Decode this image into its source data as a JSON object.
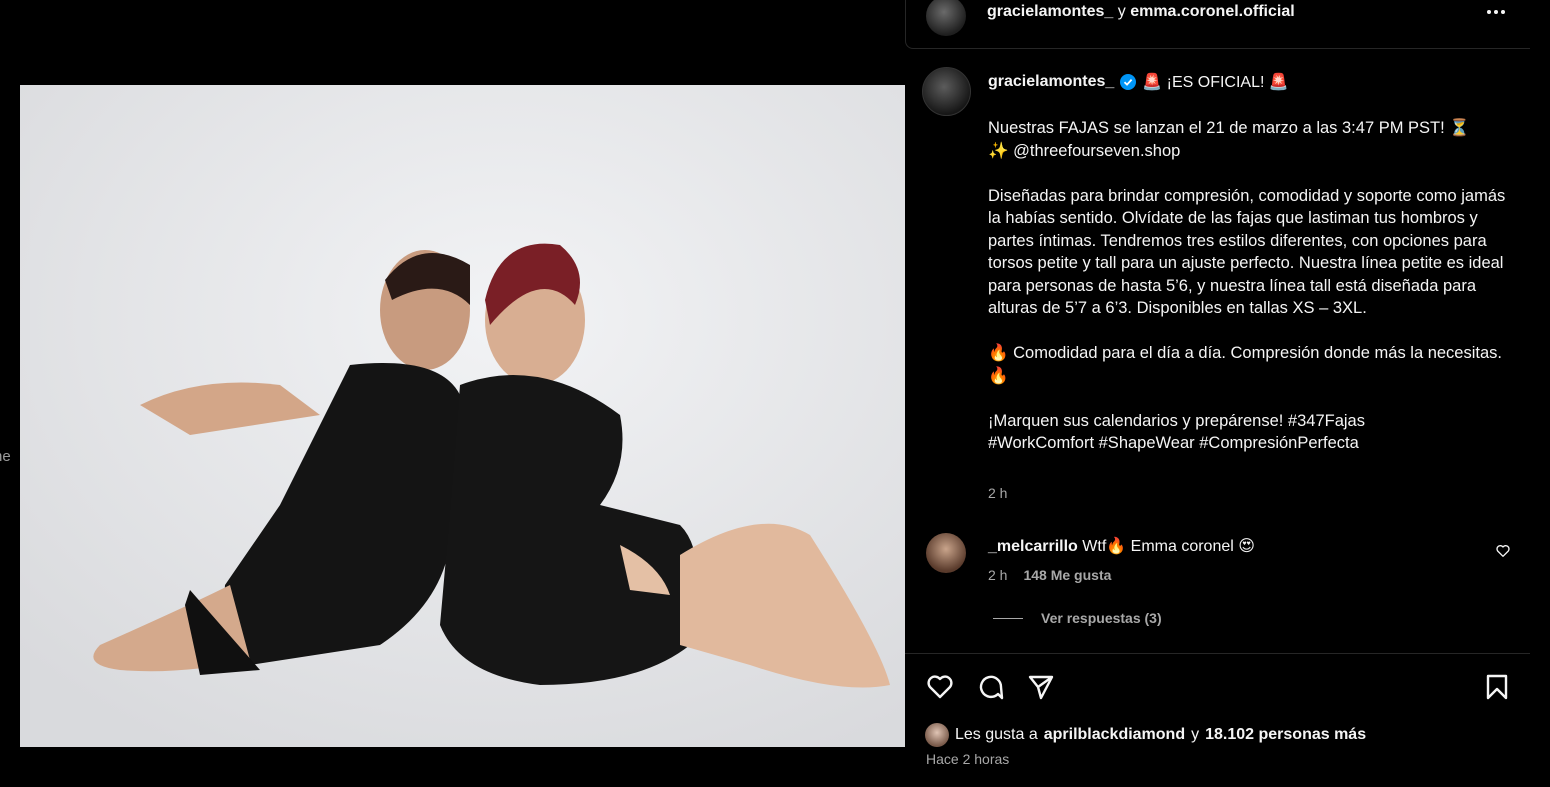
{
  "side_peek_text": "ne",
  "header": {
    "user1": "gracielamontes_",
    "separator": "y",
    "user2": "emma.coronel.official"
  },
  "post": {
    "author": "gracielamontes_",
    "title_line": "🚨 ¡ES OFICIAL! 🚨",
    "caption": "Nuestras FAJAS se lanzan el 21 de marzo a las 3:47 PM PST! ⏳\n✨ @threefourseven.shop\n\nDiseñadas para brindar compresión, comodidad y soporte como jamás la habías sentido. Olvídate de las fajas que lastiman tus hombros y partes íntimas. Tendremos tres estilos diferentes, con opciones para torsos petite y tall para un ajuste perfecto. Nuestra línea petite es ideal para personas de hasta 5’6, y nuestra línea tall está diseñada para alturas de 5’7 a 6’3. Disponibles en tallas XS – 3XL.\n\n🔥 Comodidad para el día a día. Compresión donde más la necesitas. 🔥\n\n¡Marquen sus calendarios y prepárense! #347Fajas\n#WorkComfort #ShapeWear #CompresiónPerfecta",
    "time": "2 h"
  },
  "comment": {
    "user": "_melcarrillo",
    "text": "Wtf🔥 Emma coronel 😍",
    "time": "2 h",
    "likes": "148 Me gusta",
    "replies": "Ver respuestas (3)"
  },
  "likes": {
    "prefix": "Les gusta a",
    "user": "aprilblackdiamond",
    "connector": "y",
    "others": "18.102 personas más"
  },
  "ago": "Hace 2 horas",
  "icons": [
    "more-icon",
    "verified-icon",
    "user-tag-icon",
    "heart-icon",
    "comment-icon",
    "share-icon",
    "bookmark-icon"
  ]
}
